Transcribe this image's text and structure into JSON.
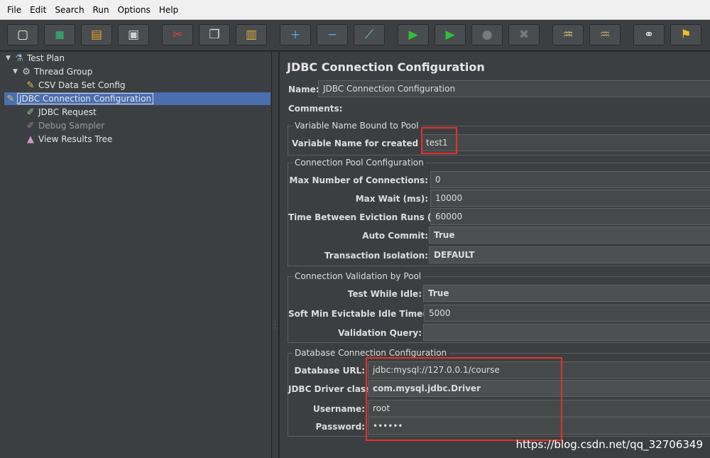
{
  "menu": [
    "File",
    "Edit",
    "Search",
    "Run",
    "Options",
    "Help"
  ],
  "toolbar": [
    {
      "icon": "new-icon",
      "glyph": "▢",
      "color": "#f4f4e0"
    },
    {
      "icon": "templates-icon",
      "glyph": "◼",
      "color": "#3a9a6a"
    },
    {
      "icon": "open-icon",
      "glyph": "▤",
      "color": "#e8a030"
    },
    {
      "icon": "save-icon",
      "glyph": "▣",
      "color": "#cfcfcf"
    },
    {
      "icon": "cut-icon",
      "glyph": "✂",
      "color": "#e04040"
    },
    {
      "icon": "copy-icon",
      "glyph": "❐",
      "color": "#d8d8d8"
    },
    {
      "icon": "paste-icon",
      "glyph": "▥",
      "color": "#e0b040"
    },
    {
      "icon": "expand-icon",
      "glyph": "+",
      "color": "#4aa3e8"
    },
    {
      "icon": "collapse-icon",
      "glyph": "−",
      "color": "#4aa3e8"
    },
    {
      "icon": "toggle-icon",
      "glyph": "⟋",
      "color": "#80c0e0"
    },
    {
      "icon": "start-icon",
      "glyph": "▶",
      "color": "#2fbf3a"
    },
    {
      "icon": "start-no-pauses-icon",
      "glyph": "▶",
      "color": "#2fbf3a"
    },
    {
      "icon": "stop-icon",
      "glyph": "●",
      "color": "#7a7a7a"
    },
    {
      "icon": "shutdown-icon",
      "glyph": "✖",
      "color": "#7a7a7a"
    },
    {
      "icon": "clear-icon",
      "glyph": "♒",
      "color": "#d0c070"
    },
    {
      "icon": "clear-all-icon",
      "glyph": "♒",
      "color": "#c0a060"
    },
    {
      "icon": "search-icon",
      "glyph": "⚭",
      "color": "#dcdcdc"
    },
    {
      "icon": "reset-search-icon",
      "glyph": "⚑",
      "color": "#f0c020"
    }
  ],
  "tree": [
    {
      "label": "Test Plan",
      "icon": "flask-icon",
      "glyph": "⚗",
      "iconColor": "#9ab",
      "twisty": "▼",
      "disabled": false,
      "selected": false
    },
    {
      "label": "Thread Group",
      "icon": "gear-icon",
      "glyph": "⚙",
      "iconColor": "#ccc",
      "twisty": "▼",
      "disabled": false,
      "selected": false
    },
    {
      "label": "CSV Data Set Config",
      "icon": "wrench-icon",
      "glyph": "✎",
      "iconColor": "#e0c050",
      "twisty": "",
      "disabled": false,
      "selected": false
    },
    {
      "label": "JDBC Connection Configuration",
      "icon": "wrench-icon",
      "glyph": "✎",
      "iconColor": "#e0c050",
      "twisty": "",
      "disabled": false,
      "selected": true
    },
    {
      "label": "JDBC Request",
      "icon": "pipette-icon",
      "glyph": "✐",
      "iconColor": "#9c9",
      "twisty": "",
      "disabled": false,
      "selected": false
    },
    {
      "label": "Debug Sampler",
      "icon": "pipette-icon",
      "glyph": "✐",
      "iconColor": "#888",
      "twisty": "",
      "disabled": true,
      "selected": false
    },
    {
      "label": "View Results Tree",
      "icon": "chart-icon",
      "glyph": "▲",
      "iconColor": "#c9c",
      "twisty": "",
      "disabled": false,
      "selected": false
    }
  ],
  "form": {
    "title": "JDBC Connection Configuration",
    "name_label": "Name:",
    "name_value": "JDBC Connection Configuration",
    "comments_label": "Comments:",
    "pool_group_title": "Variable Name Bound to Pool",
    "var_name_label": "Variable Name for created pool:",
    "var_name_value": "test1",
    "conn_pool_title": "Connection Pool Configuration",
    "max_conn_label": "Max Number of Connections:",
    "max_conn_value": "0",
    "max_wait_label": "Max Wait (ms):",
    "max_wait_value": "10000",
    "eviction_label": "Time Between Eviction Runs (ms):",
    "eviction_value": "60000",
    "auto_commit_label": "Auto Commit:",
    "auto_commit_value": "True",
    "isolation_label": "Transaction Isolation:",
    "isolation_value": "DEFAULT",
    "validation_title": "Connection Validation by Pool",
    "test_idle_label": "Test While Idle:",
    "test_idle_value": "True",
    "soft_min_label": "Soft Min Evictable Idle Time(ms):",
    "soft_min_value": "5000",
    "validation_query_label": "Validation Query:",
    "validation_query_value": "",
    "db_title": "Database Connection Configuration",
    "db_url_label": "Database URL:",
    "db_url_value": "jdbc:mysql://127.0.0.1/course",
    "driver_label": "JDBC Driver class:",
    "driver_value": "com.mysql.jdbc.Driver",
    "username_label": "Username:",
    "username_value": "root",
    "password_label": "Password:",
    "password_value": "••••••"
  },
  "watermark": "https://blog.csdn.net/qq_32706349",
  "colors": {
    "highlight": "#e8302a",
    "selection": "#4b6eaf",
    "panel": "#3c3f41"
  }
}
